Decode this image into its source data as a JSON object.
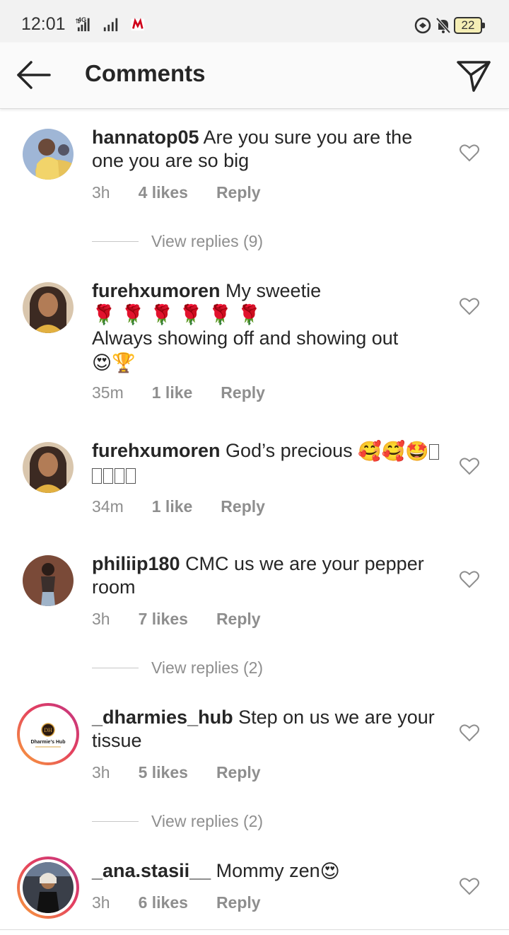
{
  "status_bar": {
    "time": "12:01",
    "network": "4G",
    "battery": "22"
  },
  "header": {
    "title": "Comments"
  },
  "comments": [
    {
      "username": "hannatop05",
      "text": "Are you sure you are the one you are so big",
      "time": "3h",
      "likes": "4 likes",
      "reply": "Reply",
      "view_replies": "View replies (9)"
    },
    {
      "username": "furehxumoren",
      "text_line1": "My sweetie",
      "text_line2": "Always showing off and showing out",
      "time": "35m",
      "likes": "1 like",
      "reply": "Reply"
    },
    {
      "username": "furehxumoren",
      "text": "God’s precious",
      "time": "34m",
      "likes": "1 like",
      "reply": "Reply"
    },
    {
      "username": "philiip180",
      "text": "CMC us we are your pepper room",
      "time": "3h",
      "likes": "7 likes",
      "reply": "Reply",
      "view_replies": "View replies (2)"
    },
    {
      "username": "_dharmies_hub",
      "text": "Step on us we are your tissue",
      "time": "3h",
      "likes": "5 likes",
      "reply": "Reply",
      "view_replies": "View replies (2)",
      "avatar_text": "Dharmie's Hub"
    },
    {
      "username": "_ana.stasii__",
      "text": "Mommy zen",
      "time": "3h",
      "likes": "6 likes",
      "reply": "Reply"
    }
  ],
  "colors": {
    "accent_gradient_start": "#f9a33a",
    "accent_gradient_end": "#c13584",
    "text_primary": "#262626",
    "text_secondary": "#8e8e8e"
  },
  "icons": {
    "back": "arrow-left-icon",
    "send": "paper-plane-icon",
    "like": "heart-outline-icon"
  }
}
